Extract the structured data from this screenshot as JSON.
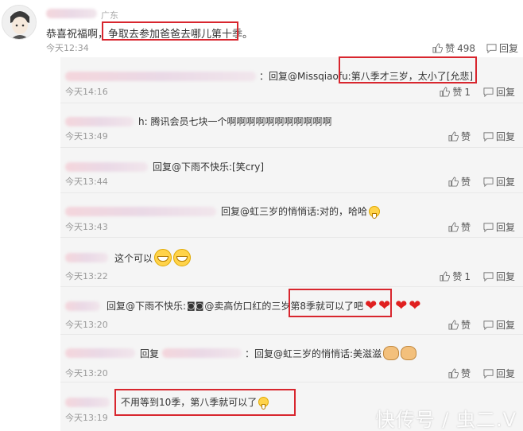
{
  "main_comment": {
    "location": "广东",
    "text_before": "恭喜祝福啊，",
    "text_highlight": "争取去参加爸爸去哪儿第十季。",
    "time": "今天12:34",
    "like_label": "赞",
    "like_count": "498",
    "reply_label": "回复"
  },
  "replies": [
    {
      "text": "：回复@Missqiaofu:",
      "highlight": "第八季才三岁，太小了[允悲]",
      "time": "今天14:16",
      "like_label": "赞",
      "like_count": "1",
      "reply_label": "回复"
    },
    {
      "text": "h: 腾讯会员七块一个啊啊啊啊啊啊啊啊啊啊啊",
      "time": "今天13:49",
      "like_label": "赞",
      "reply_label": "回复"
    },
    {
      "text": "回复@下雨不快乐:[笑cry]",
      "time": "今天13:44",
      "like_label": "赞",
      "reply_label": "回复"
    },
    {
      "text": "回复@虹三岁的悄悄话:对的，哈哈",
      "time": "今天13:43",
      "like_label": "赞",
      "reply_label": "回复"
    },
    {
      "text": "这个可以",
      "time": "今天13:22",
      "like_label": "赞",
      "like_count": "1",
      "reply_label": "回复"
    },
    {
      "text": "回复@下雨不快乐:",
      "text2": "@卖高仿口红的三岁",
      "highlight": "第8季就可以了吧",
      "time": "今天13:20",
      "like_label": "赞",
      "reply_label": "回复"
    },
    {
      "text": "回复",
      "text2": "：回复@虹三岁的悄悄话:美滋滋",
      "time": "今天13:20",
      "like_label": "赞",
      "reply_label": "回复"
    },
    {
      "highlight": "不用等到10季，第八季就可以了",
      "time": "今天13:19"
    }
  ],
  "watermark": "快传号 / 虫二.V",
  "icons": {
    "like": "thumbs-up-icon",
    "reply": "comment-icon"
  },
  "colors": {
    "highlight_box": "#d8262e",
    "panel_bg": "#f5f5f5",
    "time_text": "#999999"
  }
}
